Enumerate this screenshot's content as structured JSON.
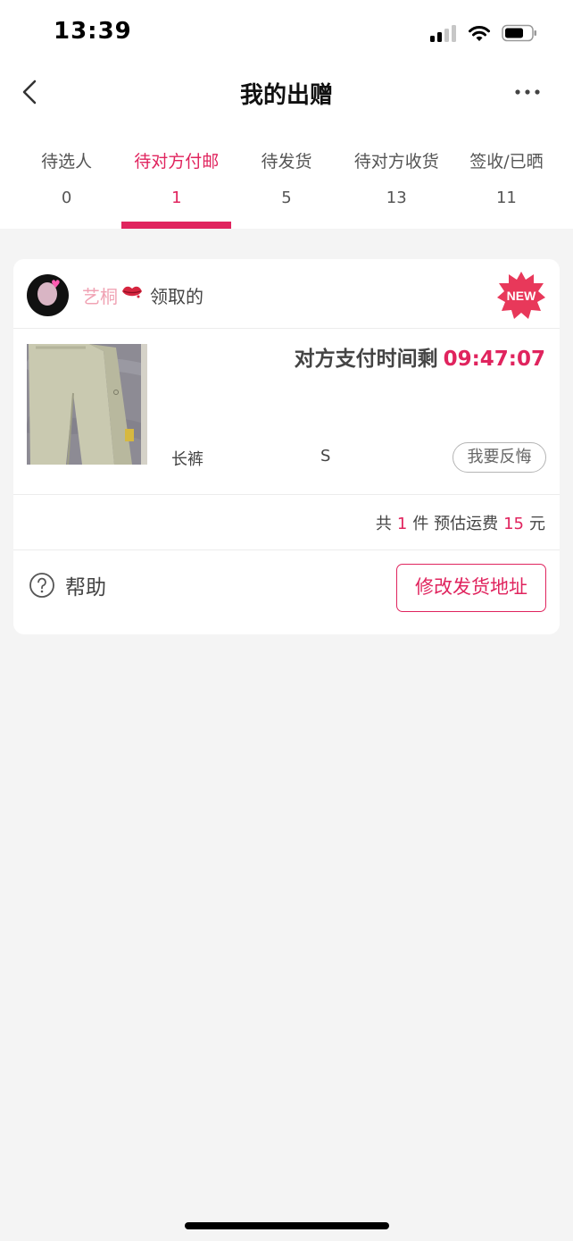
{
  "status_bar": {
    "time": "13:39",
    "icons": [
      "signal-icon",
      "wifi-icon",
      "battery-icon"
    ]
  },
  "nav": {
    "title": "我的出赠",
    "back_icon": "chevron-left-icon",
    "more_icon": "more-dots-icon"
  },
  "tabs": [
    {
      "label": "待选人",
      "count": "0",
      "active": false
    },
    {
      "label": "待对方付邮",
      "count": "1",
      "active": true
    },
    {
      "label": "待发货",
      "count": "5",
      "active": false
    },
    {
      "label": "待对方收货",
      "count": "13",
      "active": false
    },
    {
      "label": "签收/已晒",
      "count": "11",
      "active": false
    }
  ],
  "order": {
    "username": "艺桐",
    "username_emoji": "lips-icon",
    "claimed_label": "领取的",
    "new_badge": "NEW",
    "countdown_label": "对方支付时间剩",
    "countdown_time": "09:47:07",
    "item_name": "长裤",
    "item_size": "S",
    "regret_button": "我要反悔",
    "summary": {
      "prefix": "共",
      "count": "1",
      "unit": "件 预估运费",
      "fee": "15",
      "currency": "元"
    },
    "help_label": "帮助",
    "modify_button": "修改发货地址"
  },
  "colors": {
    "accent": "#e0245e",
    "username": "#f0a3b4",
    "background": "#f4f4f4"
  }
}
